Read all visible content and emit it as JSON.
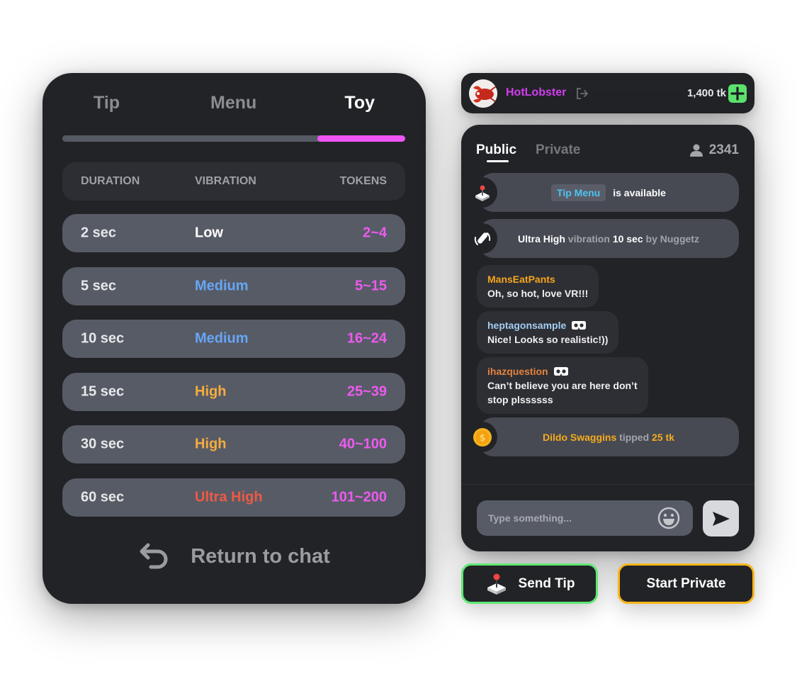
{
  "toy_panel": {
    "tabs": [
      {
        "label": "Tip",
        "active": false
      },
      {
        "label": "Menu",
        "active": false
      },
      {
        "label": "Toy",
        "active": true
      }
    ],
    "progress": {
      "start_fraction": 0.744,
      "end_fraction": 1.0,
      "fill_color": "#ef55f5"
    },
    "table": {
      "headers": [
        "DURATION",
        "VIBRATION",
        "TOKENS"
      ],
      "rows": [
        {
          "duration": "2 sec",
          "vibration": "Low",
          "tokens": "2~4",
          "vibration_color": "#ffffff"
        },
        {
          "duration": "5 sec",
          "vibration": "Medium",
          "tokens": "5~15",
          "vibration_color": "#66a6f6"
        },
        {
          "duration": "10 sec",
          "vibration": "Medium",
          "tokens": "16~24",
          "vibration_color": "#66a6f6"
        },
        {
          "duration": "15 sec",
          "vibration": "High",
          "tokens": "25~39",
          "vibration_color": "#f7ad3d"
        },
        {
          "duration": "30 sec",
          "vibration": "High",
          "tokens": "40~100",
          "vibration_color": "#f7ad3d"
        },
        {
          "duration": "60 sec",
          "vibration": "Ultra High",
          "tokens": "101~200",
          "vibration_color": "#ef5a43"
        }
      ]
    },
    "return_label": "Return to chat"
  },
  "user_bar": {
    "avatar": "lobster-avatar",
    "username": "HotLobster",
    "balance": "1,400 tk",
    "add_icon": "plus-icon",
    "logout_icon": "logout-icon"
  },
  "chat": {
    "tabs": [
      {
        "label": "Public",
        "active": true
      },
      {
        "label": "Private",
        "active": false
      }
    ],
    "viewer_count": "2341",
    "system_tip_menu": {
      "chip": "Tip Menu",
      "text": "is available"
    },
    "system_vibration": {
      "level": "Ultra High",
      "word": "vibration",
      "duration": "10 sec",
      "by": "by Nuggetz"
    },
    "messages": [
      {
        "user": "MansEatPants",
        "text": "Oh, so hot, love VR!!!",
        "user_color": "#f6a51e",
        "vr_badge": false
      },
      {
        "user": "heptagonsample",
        "text": "Nice! Looks so realistic!))",
        "user_color": "#a3cdf4",
        "vr_badge": true
      },
      {
        "user": "ihazquestion",
        "text_line1": "Can’t believe you are here don’t",
        "text_line2": "stop plssssss",
        "user_color": "#e5833e",
        "vr_badge": true
      }
    ],
    "system_tip": {
      "user": "Dildo Swaggins",
      "word": "tipped",
      "amount": "25 tk"
    },
    "input": {
      "placeholder": "Type something...",
      "value": ""
    }
  },
  "buttons": {
    "send_tip": "Send Tip",
    "start_private": "Start Private"
  }
}
